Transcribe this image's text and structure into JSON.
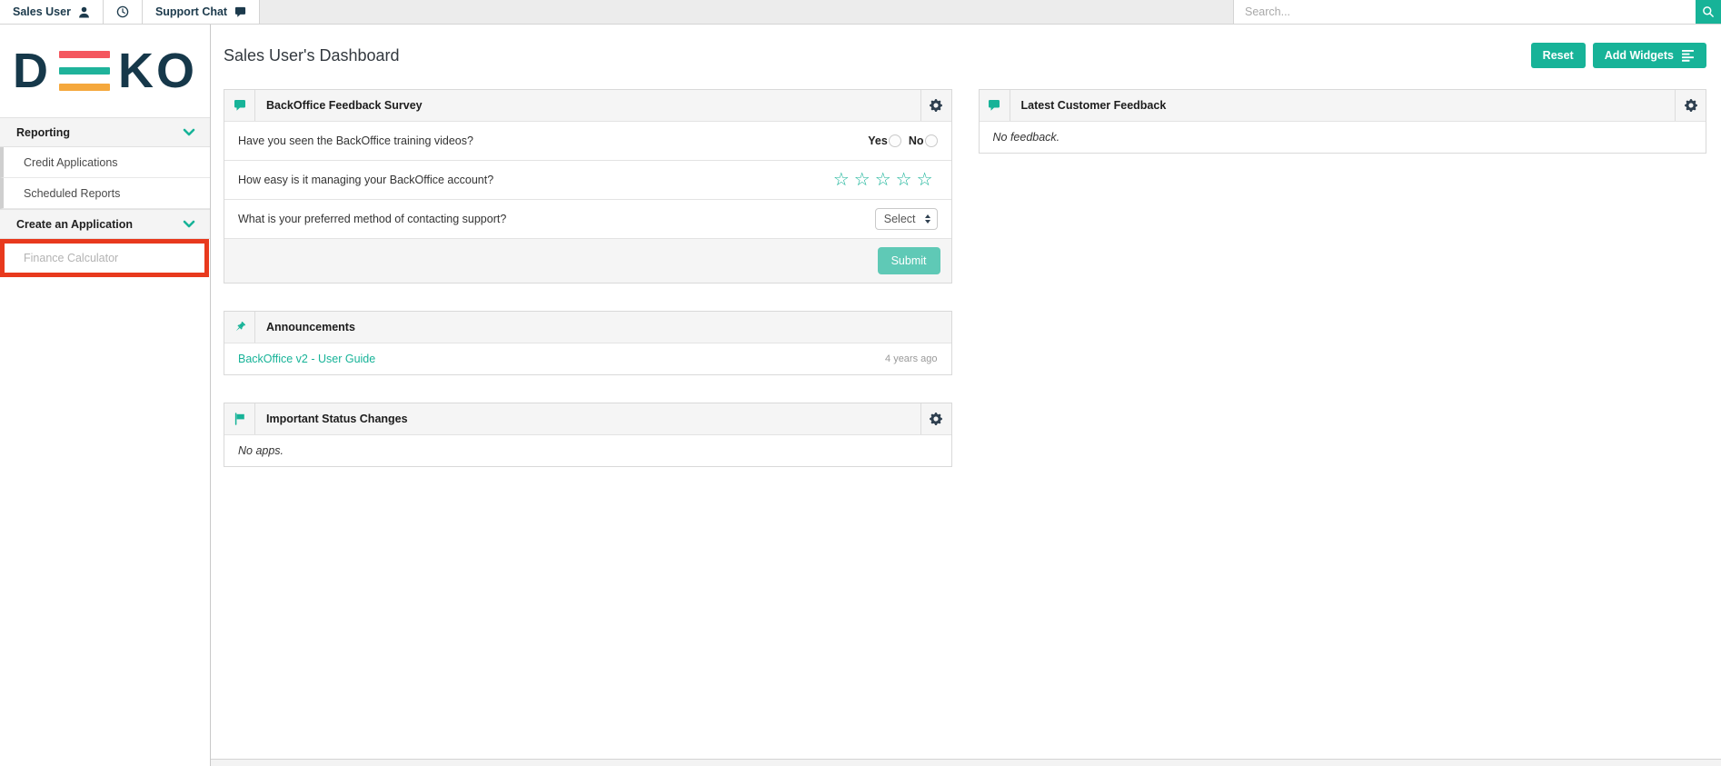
{
  "colors": {
    "accent_teal": "#17b398",
    "navy": "#1c3a4c",
    "logo_red": "#f4575f",
    "logo_teal": "#1fb39b",
    "logo_orange": "#f5a83c",
    "annotation_red": "#e8391d",
    "submit_teal": "#5fc9b6"
  },
  "topbar": {
    "user_tab": "Sales User",
    "support_tab": "Support Chat",
    "search_placeholder": "Search..."
  },
  "sidebar": {
    "logo": {
      "letter_d": "D",
      "letters_ko": "KO"
    },
    "sections": [
      {
        "label": "Reporting",
        "items": [
          "Credit Applications",
          "Scheduled Reports"
        ]
      },
      {
        "label": "Create an Application",
        "items": [
          "Finance Calculator"
        ]
      }
    ]
  },
  "main": {
    "title": "Sales User's Dashboard",
    "reset_button": "Reset",
    "add_widgets_button": "Add Widgets"
  },
  "widgets": {
    "survey": {
      "title": "BackOffice Feedback Survey",
      "questions": [
        {
          "text": "Have you seen the BackOffice training videos?",
          "type": "radio",
          "options": [
            "Yes",
            "No"
          ]
        },
        {
          "text": "How easy is it managing your BackOffice account?",
          "type": "stars",
          "stars_count": 5
        },
        {
          "text": "What is your preferred method of contacting support?",
          "type": "select",
          "value": "Select"
        }
      ],
      "star_icon": "☆",
      "submit_label": "Submit"
    },
    "announcements": {
      "title": "Announcements",
      "items": [
        {
          "link": "BackOffice v2 - User Guide",
          "time": "4 years ago"
        }
      ]
    },
    "status_changes": {
      "title": "Important Status Changes",
      "empty": "No apps."
    },
    "customer_feedback": {
      "title": "Latest Customer Feedback",
      "empty": "No feedback."
    }
  }
}
